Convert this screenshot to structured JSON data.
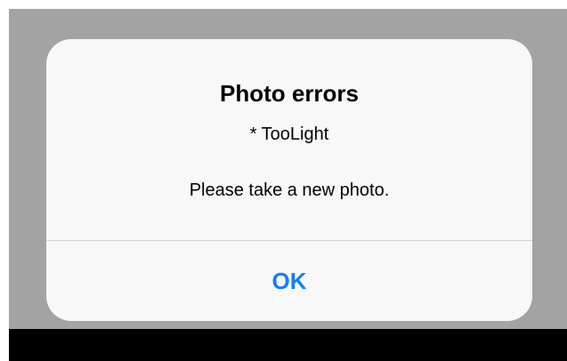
{
  "alert": {
    "title": "Photo errors",
    "error_item": "* TooLight",
    "message": "Please take a new photo.",
    "ok_label": "OK"
  },
  "colors": {
    "backdrop": "#a3a3a3",
    "alert_background": "#f8f8f8",
    "button_text": "#147efb",
    "bottom_bar": "#000000"
  }
}
